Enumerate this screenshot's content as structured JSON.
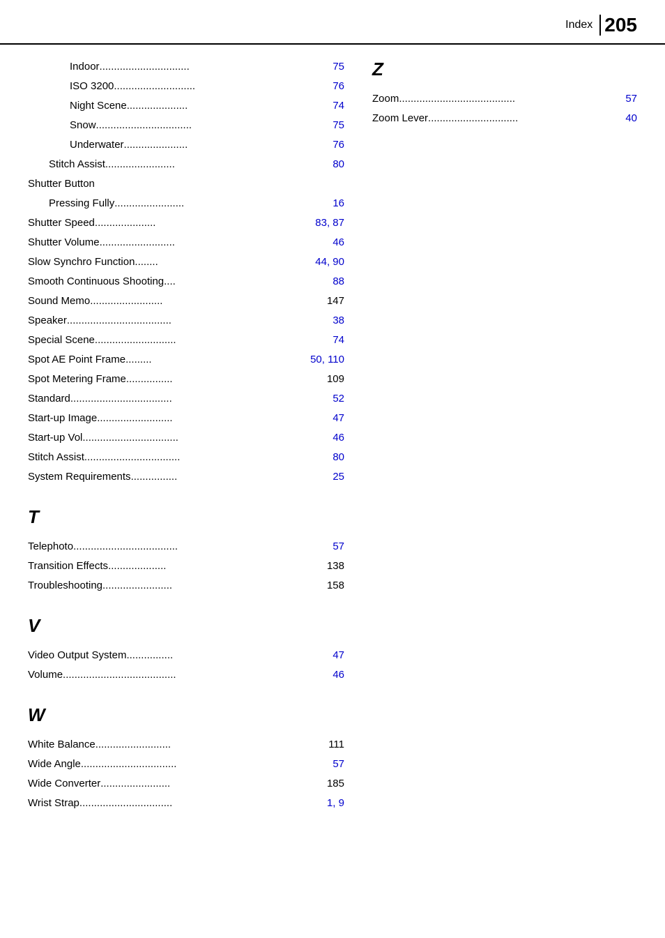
{
  "header": {
    "index_label": "Index",
    "page_number": "205"
  },
  "left_column": {
    "entries_before_shutter": [
      {
        "text": "Indoor",
        "dots": ".............................",
        "page": "75",
        "indent": 2,
        "page_color": "blue"
      },
      {
        "text": "ISO 3200",
        "dots": "........................",
        "page": "76",
        "indent": 2,
        "page_color": "blue"
      },
      {
        "text": "Night Scene",
        "dots": "...................",
        "page": "74",
        "indent": 2,
        "page_color": "blue"
      },
      {
        "text": "Snow",
        "dots": "............................",
        "page": "75",
        "indent": 2,
        "page_color": "blue"
      },
      {
        "text": "Underwater",
        "dots": "...................",
        "page": "76",
        "indent": 2,
        "page_color": "blue"
      },
      {
        "text": "Stitch Assist",
        "dots": "........................",
        "page": "80",
        "indent": 1,
        "page_color": "blue"
      }
    ],
    "shutter_button_group": {
      "header": "Shutter Button",
      "sub_entries": [
        {
          "text": "Pressing Fully",
          "dots": "........................",
          "page": "16",
          "indent": 1,
          "page_color": "blue"
        }
      ]
    },
    "entries_after_shutter": [
      {
        "text": "Shutter Speed",
        "dots": ".....................",
        "page": "83, 87",
        "indent": 0,
        "page_color": "blue"
      },
      {
        "text": "Shutter Volume",
        "dots": "..........................",
        "page": "46",
        "indent": 0,
        "page_color": "blue"
      },
      {
        "text": "Slow Synchro Function",
        "dots": "........",
        "page": "44, 90",
        "indent": 0,
        "page_color": "blue"
      },
      {
        "text": "Smooth Continuous Shooting",
        "dots": "....",
        "page": "88",
        "indent": 0,
        "page_color": "blue"
      },
      {
        "text": "Sound Memo",
        "dots": ".........................",
        "page": "147",
        "indent": 0,
        "page_color": "black"
      },
      {
        "text": "Speaker",
        "dots": "....................................",
        "page": "38",
        "indent": 0,
        "page_color": "blue"
      },
      {
        "text": "Special Scene",
        "dots": "............................",
        "page": "74",
        "indent": 0,
        "page_color": "blue"
      },
      {
        "text": "Spot AE Point Frame",
        "dots": ".........",
        "page": "50, 110",
        "indent": 0,
        "page_color": "blue"
      },
      {
        "text": "Spot Metering Frame",
        "dots": "................",
        "page": "109",
        "indent": 0,
        "page_color": "black"
      },
      {
        "text": "Standard",
        "dots": "....................................",
        "page": "52",
        "indent": 0,
        "page_color": "blue"
      },
      {
        "text": "Start-up Image",
        "dots": "..........................",
        "page": "47",
        "indent": 0,
        "page_color": "blue"
      },
      {
        "text": "Start-up Vol.",
        "dots": "................................",
        "page": "46",
        "indent": 0,
        "page_color": "blue"
      },
      {
        "text": "Stitch Assist",
        "dots": ".................................",
        "page": "80",
        "indent": 0,
        "page_color": "blue"
      },
      {
        "text": "System Requirements",
        "dots": "................",
        "page": "25",
        "indent": 0,
        "page_color": "blue"
      }
    ],
    "section_t": {
      "header": "T",
      "entries": [
        {
          "text": "Telephoto",
          "dots": "....................................",
          "page": "57",
          "indent": 0,
          "page_color": "blue"
        },
        {
          "text": "Transition Effects",
          "dots": "......................",
          "page": "138",
          "indent": 0,
          "page_color": "black"
        },
        {
          "text": "Troubleshooting",
          "dots": "........................",
          "page": "158",
          "indent": 0,
          "page_color": "black"
        }
      ]
    },
    "section_v": {
      "header": "V",
      "entries": [
        {
          "text": "Video Output System",
          "dots": "................",
          "page": "47",
          "indent": 0,
          "page_color": "blue"
        },
        {
          "text": "Volume",
          "dots": ".......................................",
          "page": "46",
          "indent": 0,
          "page_color": "blue"
        }
      ]
    },
    "section_w": {
      "header": "W",
      "entries": [
        {
          "text": "White Balance",
          "dots": "..........................",
          "page": "111",
          "indent": 0,
          "page_color": "black"
        },
        {
          "text": "Wide Angle",
          "dots": ".................................",
          "page": "57",
          "indent": 0,
          "page_color": "blue"
        },
        {
          "text": "Wide Converter",
          "dots": "........................",
          "page": "185",
          "indent": 0,
          "page_color": "black"
        },
        {
          "text": "Wrist Strap",
          "dots": "................................",
          "page": "1, 9",
          "indent": 0,
          "page_color": "blue"
        }
      ]
    }
  },
  "right_column": {
    "section_z": {
      "header": "Z",
      "entries": [
        {
          "text": "Zoom",
          "dots": "........................................",
          "page": "57",
          "indent": 0,
          "page_color": "blue"
        },
        {
          "text": "Zoom Lever",
          "dots": "...............................",
          "page": "40",
          "indent": 0,
          "page_color": "blue"
        }
      ]
    }
  }
}
